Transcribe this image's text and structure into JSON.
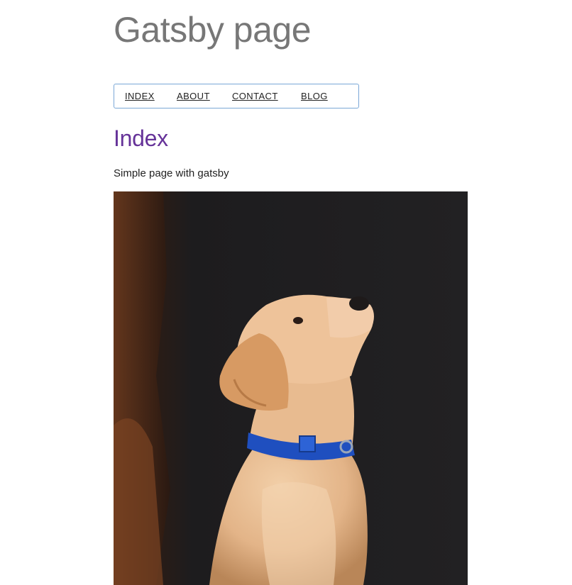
{
  "site": {
    "title": "Gatsby page"
  },
  "nav": {
    "items": [
      {
        "label": "INDEX"
      },
      {
        "label": "ABOUT"
      },
      {
        "label": "CONTACT"
      },
      {
        "label": "BLOG"
      }
    ],
    "border_color": "#7aa7d6"
  },
  "page": {
    "heading": "Index",
    "heading_color": "#663399",
    "description": "Simple page with gatsby"
  },
  "image": {
    "subject": "puppy-photo",
    "background_color": "#1e1d1f",
    "dog_color": "#e6b98f",
    "collar_color": "#1f4fbf"
  }
}
